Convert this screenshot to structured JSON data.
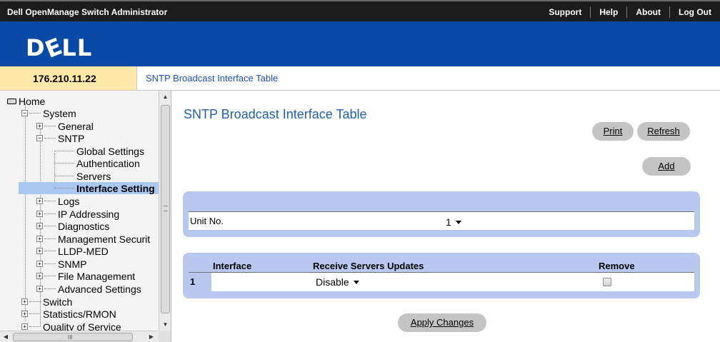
{
  "header": {
    "app_title": "Dell OpenManage Switch Administrator",
    "links": [
      "Support",
      "Help",
      "About",
      "Log Out"
    ]
  },
  "brand": {
    "logo_text": "DELL"
  },
  "device_ip": "176.210.11.22",
  "breadcrumb": "SNTP Broadcast Interface Table",
  "sidebar": {
    "tree": [
      {
        "label": "Home",
        "depth": 0,
        "icon": "home-icon"
      },
      {
        "label": "System",
        "depth": 1,
        "expander": "minus"
      },
      {
        "label": "General",
        "depth": 2,
        "expander": "plus"
      },
      {
        "label": "SNTP",
        "depth": 2,
        "expander": "minus"
      },
      {
        "label": "Global Settings",
        "depth": 3
      },
      {
        "label": "Authentication",
        "depth": 3
      },
      {
        "label": "Servers",
        "depth": 3
      },
      {
        "label": "Interface Setting",
        "depth": 3,
        "selected": true
      },
      {
        "label": "Logs",
        "depth": 2,
        "expander": "plus"
      },
      {
        "label": "IP Addressing",
        "depth": 2,
        "expander": "plus"
      },
      {
        "label": "Diagnostics",
        "depth": 2,
        "expander": "plus"
      },
      {
        "label": "Management Securit",
        "depth": 2,
        "expander": "plus"
      },
      {
        "label": "LLDP-MED",
        "depth": 2,
        "expander": "plus"
      },
      {
        "label": "SNMP",
        "depth": 2,
        "expander": "plus"
      },
      {
        "label": "File Management",
        "depth": 2,
        "expander": "plus"
      },
      {
        "label": "Advanced Settings",
        "depth": 2,
        "expander": "plus"
      },
      {
        "label": "Switch",
        "depth": 1,
        "expander": "plus"
      },
      {
        "label": "Statistics/RMON",
        "depth": 1,
        "expander": "plus"
      },
      {
        "label": "Quality of Service",
        "depth": 1,
        "expander": "plus"
      }
    ]
  },
  "main": {
    "title": "SNTP Broadcast Interface Table",
    "buttons": {
      "print": "Print",
      "refresh": "Refresh",
      "add": "Add",
      "apply": "Apply Changes"
    },
    "unit": {
      "label": "Unit No.",
      "value": "1"
    },
    "table": {
      "headers": [
        "Interface",
        "Receive Servers Updates",
        "Remove"
      ],
      "rows": [
        {
          "num": "1",
          "interface": "",
          "receive": "Disable",
          "remove": false
        }
      ]
    }
  },
  "colors": {
    "brand_blue": "#0a4aa6",
    "panel_blue": "#b8c8ee",
    "title_blue": "#2060b0",
    "ip_bg": "#ffe9a8"
  }
}
